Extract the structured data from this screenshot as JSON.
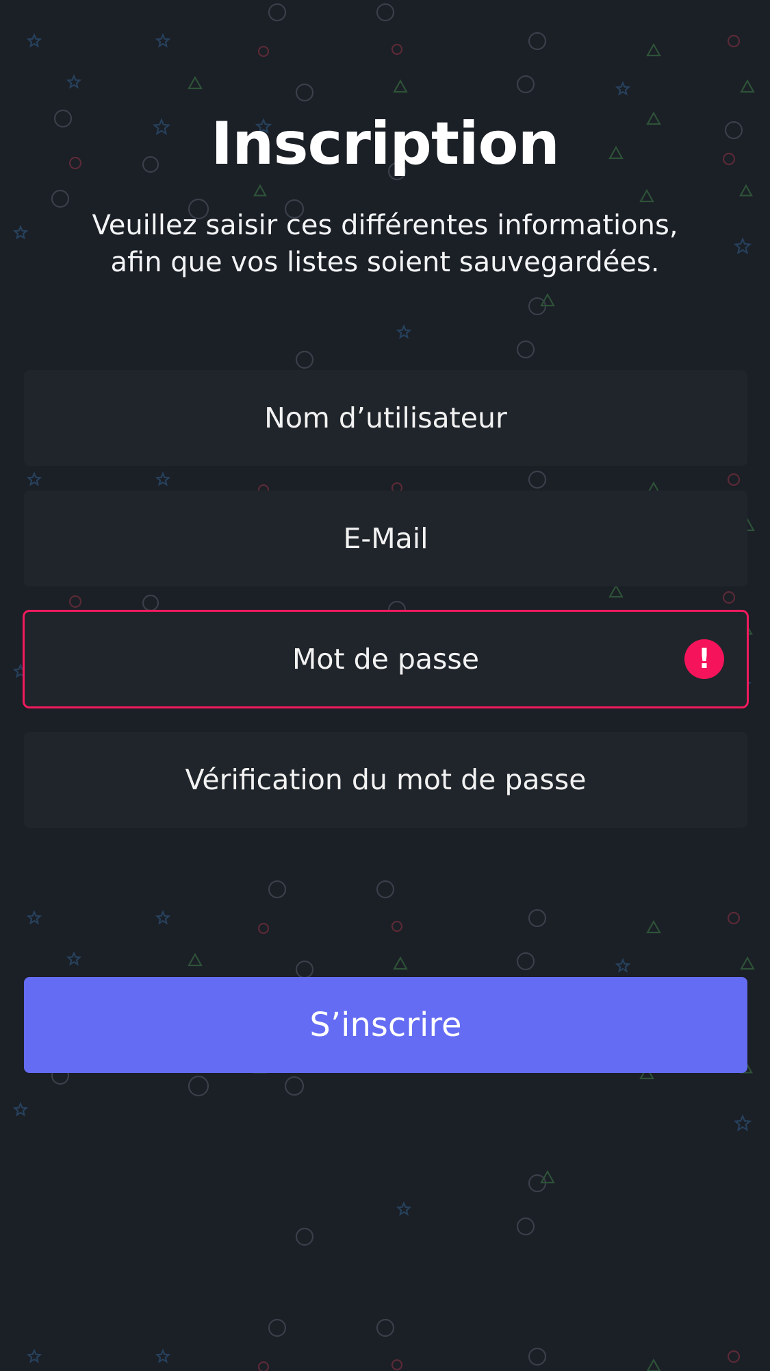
{
  "header": {
    "title": "Inscription",
    "subtitle_line1": "Veuillez saisir ces différentes informations,",
    "subtitle_line2": "afin que vos listes soient sauvegardées."
  },
  "form": {
    "username_placeholder": "Nom d’utilisateur",
    "email_placeholder": "E-Mail",
    "password_placeholder": "Mot de passe",
    "password_error_symbol": "!",
    "password_confirm_placeholder": "Vérification du mot de passe",
    "submit_label": "S’inscrire"
  },
  "colors": {
    "background": "#1b1f26",
    "field_background": "#20252b",
    "error": "#f21a5e",
    "accent": "#646cf3"
  }
}
